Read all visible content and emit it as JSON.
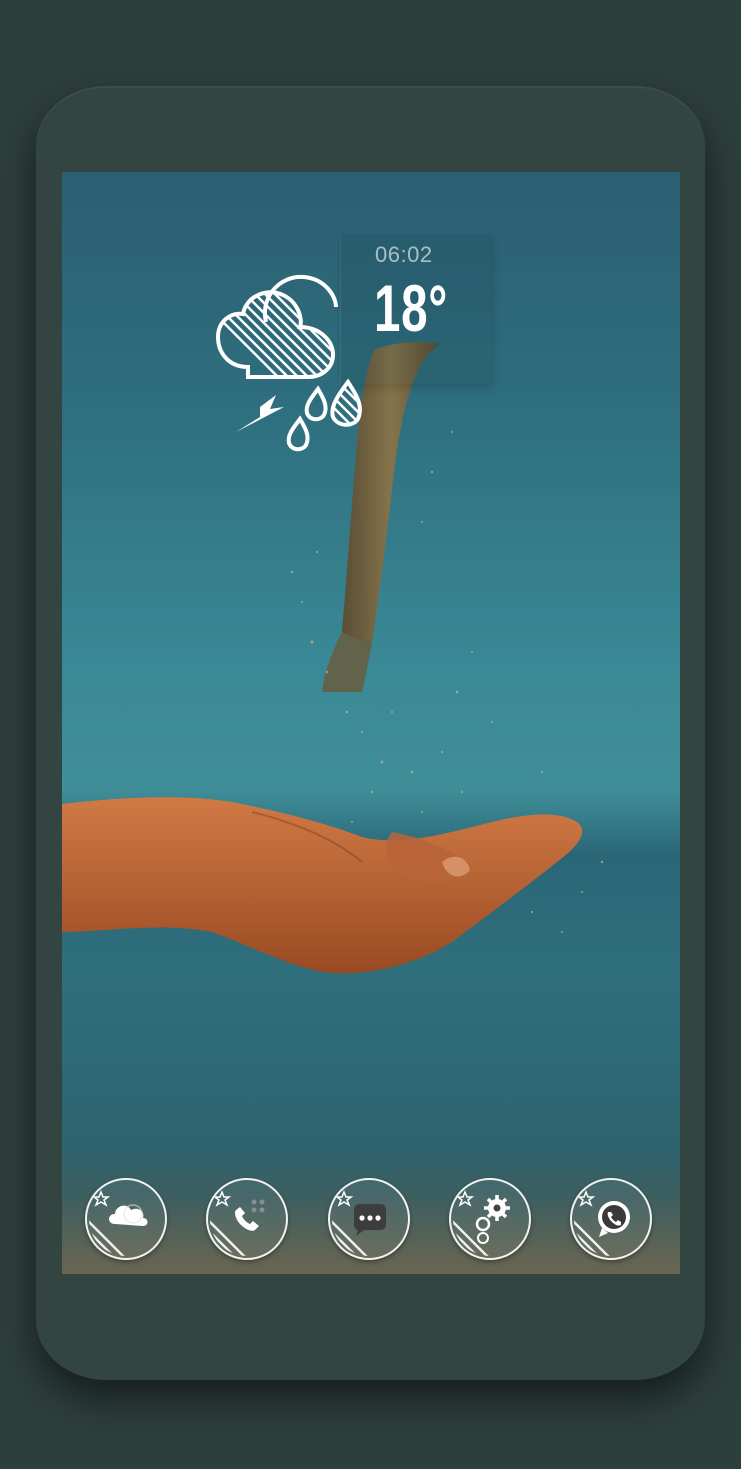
{
  "weather_widget": {
    "time": "06:02",
    "temperature": "18°",
    "condition_icon": "thunderstorm-rain-icon"
  },
  "dock": {
    "apps": [
      {
        "id": "weather",
        "icon": "cloud-icon"
      },
      {
        "id": "phone",
        "icon": "phone-icon"
      },
      {
        "id": "messages",
        "icon": "chat-bubble-icon"
      },
      {
        "id": "settings",
        "icon": "gears-icon"
      },
      {
        "id": "whatsapp",
        "icon": "whatsapp-icon"
      }
    ]
  },
  "colors": {
    "phone_body": "#324541",
    "background": "#2d3f3c",
    "sky": "#2e6d7d",
    "sea": "#2b6677",
    "icon_stroke": "#ffffff"
  }
}
